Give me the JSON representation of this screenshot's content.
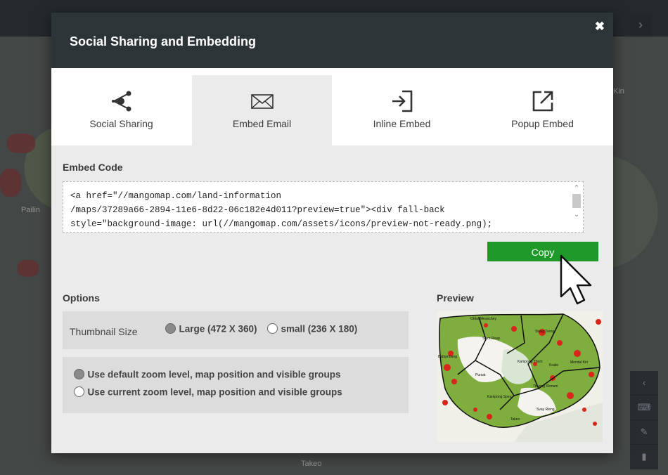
{
  "background": {
    "labels": [
      "Pailin",
      "Kin",
      "Takeo"
    ]
  },
  "modal": {
    "title": "Social Sharing and Embedding",
    "close_icon": "close-icon"
  },
  "tabs": [
    {
      "label": "Social Sharing",
      "icon": "share-icon",
      "active": false
    },
    {
      "label": "Embed Email",
      "icon": "envelope-icon",
      "active": true
    },
    {
      "label": "Inline Embed",
      "icon": "login-arrow-icon",
      "active": false
    },
    {
      "label": "Popup Embed",
      "icon": "external-link-icon",
      "active": false
    }
  ],
  "embed": {
    "label": "Embed Code",
    "code": "<a href=\"//mangomap.com/land-information\n/maps/37289a66-2894-11e6-8d22-06c182e4d011?preview=true\"><div fall-back\nstyle=\"background-image: url(//mangomap.com/assets/icons/preview-not-ready.png);",
    "copy_label": "Copy"
  },
  "options": {
    "label": "Options",
    "thumbnail_label": "Thumbnail Size",
    "thumb_large": "Large (472 X 360)",
    "thumb_small": "small (236 X 180)",
    "thumb_selected": "large",
    "zoom_default": "Use default zoom level, map position and visible groups",
    "zoom_current": "Use current zoom level, map position and visible groups",
    "zoom_selected": "default"
  },
  "preview": {
    "label": "Preview",
    "places": [
      "Otdar Meanchey",
      "Siem Reap",
      "Stung Treng",
      "Battambang",
      "Pursat",
      "Kampong Thom",
      "Kratie",
      "Mondul Kiri",
      "Tbuong Khmum",
      "Kampong Speu",
      "Svay Rieng",
      "Takeo"
    ]
  },
  "colors": {
    "header": "#2c3438",
    "copy_button": "#1f9a2a",
    "panel": "#ebebeb"
  }
}
